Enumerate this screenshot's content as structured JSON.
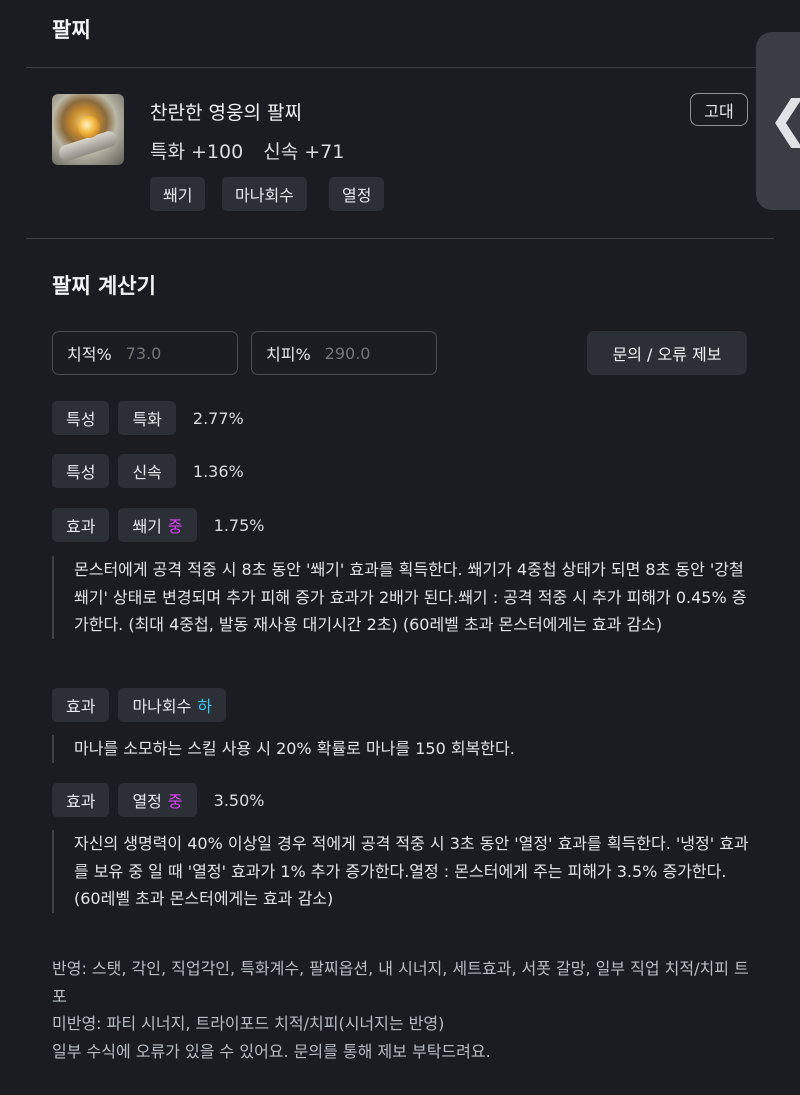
{
  "header": {
    "title": "팔찌"
  },
  "bracelet": {
    "name": "찬란한 영웅의 팔찌",
    "grade": "고대",
    "stats": [
      "특화 +100",
      "신속 +71"
    ],
    "tags": [
      "쐐기",
      "마나회수",
      "열정"
    ]
  },
  "calculator": {
    "title": "팔찌 계산기",
    "crit_rate_label": "치적%",
    "crit_rate_placeholder": "73.0",
    "crit_dmg_label": "치피%",
    "crit_dmg_placeholder": "290.0",
    "report_button": "문의 / 오류 제보"
  },
  "results": [
    {
      "type": "특성",
      "name": "특화",
      "level": "",
      "value": "2.77%",
      "description": ""
    },
    {
      "type": "특성",
      "name": "신속",
      "level": "",
      "value": "1.36%",
      "description": ""
    },
    {
      "type": "효과",
      "name": "쐐기",
      "level": "중",
      "value": "1.75%",
      "description": "몬스터에게 공격 적중 시 8초 동안 '쐐기' 효과를 획득한다. 쐐기가 4중첩 상태가 되면 8초 동안 '강철 쐐기' 상태로 변경되며 추가 피해 증가 효과가 2배가 된다.쐐기 : 공격 적중 시 추가 피해가 0.45% 증가한다. (최대 4중첩, 발동 재사용 대기시간 2초) (60레벨 초과 몬스터에게는 효과 감소)"
    },
    {
      "type": "효과",
      "name": "마나회수",
      "level": "하",
      "value": "",
      "description": "마나를 소모하는 스킬 사용 시 20% 확률로 마나를 150 회복한다."
    },
    {
      "type": "효과",
      "name": "열정",
      "level": "중",
      "value": "3.50%",
      "description": "자신의 생명력이 40% 이상일 경우 적에게 공격 적중 시 3초 동안 '열정' 효과를 획득한다. '냉정' 효과를 보유 중 일 때 '열정' 효과가 1% 추가 증가한다.열정 : 몬스터에게 주는 피해가 3.5% 증가한다. (60레벨 초과 몬스터에게는 효과 감소)"
    }
  ],
  "level_colors": {
    "중": "#e040fb",
    "하": "#38c8f0"
  },
  "footer": {
    "applied": "반영: 스탯, 각인, 직업각인, 특화계수, 팔찌옵션, 내 시너지, 세트효과, 서폿 갈망, 일부 직업 치적/치피 트포",
    "not_applied": "미반영: 파티 시너지, 트라이포드 치적/치피(시너지는 반영)",
    "notice": "일부 수식에 오류가 있을 수 있어요. 문의를 통해 제보 부탁드려요."
  }
}
